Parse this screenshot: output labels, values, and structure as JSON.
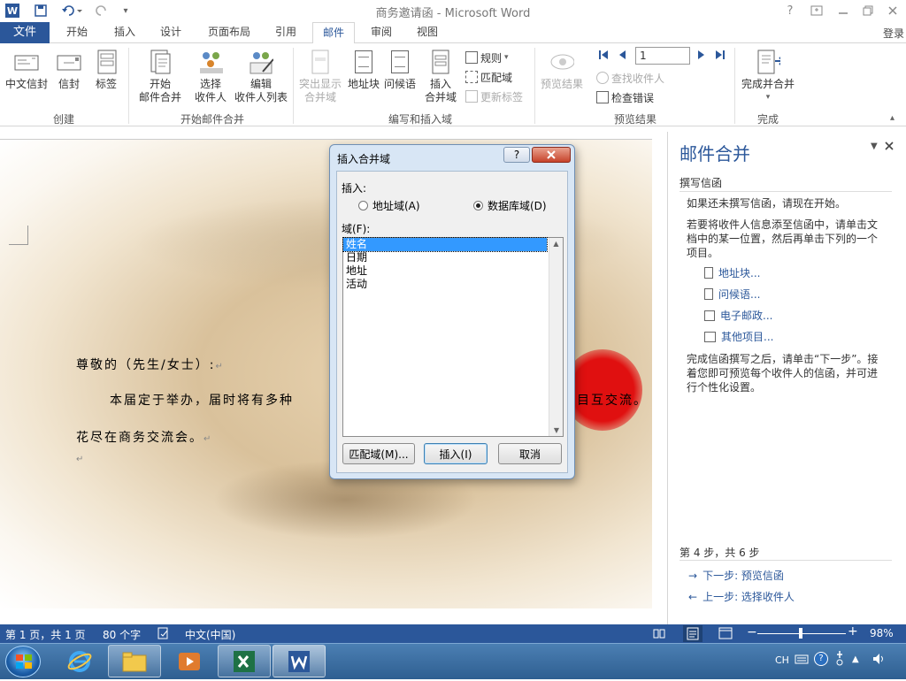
{
  "app": {
    "title": "商务邀请函 - Microsoft Word",
    "login": "登录",
    "word_icon": "W",
    "help": "?"
  },
  "tabs": [
    "文件",
    "开始",
    "插入",
    "设计",
    "页面布局",
    "引用",
    "邮件",
    "审阅",
    "视图"
  ],
  "ribbon": {
    "groups": {
      "create": "创建",
      "start_merge": "开始邮件合并",
      "write_insert": "编写和插入域",
      "preview": "预览结果",
      "finish": "完成"
    },
    "buttons": {
      "cn_envelope": "中文信封",
      "envelope": "信封",
      "labels": "标签",
      "start_merge_1": "开始",
      "start_merge_2": "邮件合并",
      "select_recipients_1": "选择",
      "select_recipients_2": "收件人",
      "edit_list_1": "编辑",
      "edit_list_2": "收件人列表",
      "highlight_1": "突出显示",
      "highlight_2": "合并域",
      "address_block": "地址块",
      "greeting": "问候语",
      "insert_field_1": "插入",
      "insert_field_2": "合并域",
      "rules": "规则",
      "match_fields": "匹配域",
      "update_labels": "更新标签",
      "preview_results": "预览结果",
      "record_number": "1",
      "find_recipient": "查找收件人",
      "check_errors": "检查错误",
      "finish_merge": "完成并合并"
    }
  },
  "document": {
    "salutation": "尊敬的（先生/女士）:",
    "para1_left": "本届定于举办，届时将有多种",
    "para1_right": "目互交流。",
    "para2": "花尽在商务交流会。",
    "para_mark": "↵"
  },
  "pane": {
    "title": "邮件合并",
    "section": "撰写信函",
    "text1": "如果还未撰写信函，请现在开始。",
    "text2": "若要将收件人信息添至信函中，请单击文档中的某一位置，然后再单击下列的一个项目。",
    "links": [
      "地址块...",
      "问候语...",
      "电子邮政...",
      "其他项目..."
    ],
    "text3": "完成信函撰写之后，请单击“下一步”。接着您即可预览每个收件人的信函，并可进行个性化设置。",
    "step": "第 4 步，共 6 步",
    "next": "下一步: 预览信函",
    "prev": "上一步: 选择收件人"
  },
  "dialog": {
    "title": "插入合并域",
    "help": "?",
    "insert_label": "插入:",
    "radio_address": "地址域(A)",
    "radio_database": "数据库域(D)",
    "fields_label": "域(F):",
    "fields": [
      "姓名",
      "日期",
      "地址",
      "活动"
    ],
    "selected_field": "姓名",
    "btn_match": "匹配域(M)...",
    "btn_insert": "插入(I)",
    "btn_cancel": "取消"
  },
  "status": {
    "page": "第 1 页，共 1 页",
    "words": "80 个字",
    "lang": "中文(中国)",
    "zoom": "98%",
    "zoom_level": 0.98
  },
  "taskbar": {
    "ime": "CH"
  }
}
